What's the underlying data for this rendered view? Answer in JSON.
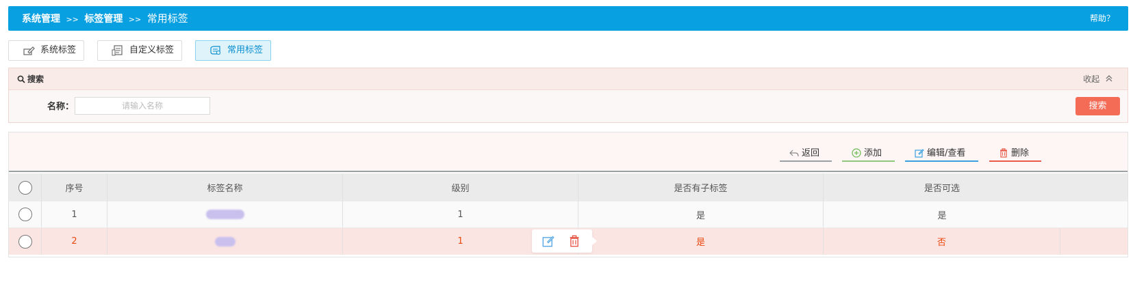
{
  "header": {
    "breadcrumb": [
      {
        "label": "系统管理"
      },
      {
        "sep": ">>"
      },
      {
        "label": "标签管理"
      },
      {
        "sep": ">>"
      },
      {
        "label": "常用标签"
      }
    ],
    "bc1": "系统管理",
    "sep1": ">>",
    "bc2": "标签管理",
    "sep2": ">>",
    "bc3": "常用标签",
    "help": "帮助？"
  },
  "tabs": [
    {
      "label": "系统标签",
      "icon": "pen-tag-icon",
      "active": false
    },
    {
      "label": "自定义标签",
      "icon": "document-list-icon",
      "active": false
    },
    {
      "label": "常用标签",
      "icon": "tag-stack-icon",
      "active": true
    }
  ],
  "search": {
    "title": "搜索",
    "collapse_label": "收起",
    "collapse_icon": "chevron-up-icon",
    "name_label": "名称：",
    "name_value": "",
    "name_placeholder": "请输入名称",
    "button_label": "搜索"
  },
  "toolbar": {
    "back": "返回",
    "add": "添加",
    "edit": "编辑/查看",
    "delete": "删除"
  },
  "table": {
    "columns": [
      "序号",
      "标签名称",
      "级别",
      "是否有子标签",
      "是否可选"
    ],
    "rows": [
      {
        "index": "1",
        "name": "",
        "level": "1",
        "has_children": "是",
        "selectable": "是"
      },
      {
        "index": "2",
        "name": "",
        "level": "1",
        "has_children": "是",
        "selectable": "否"
      }
    ]
  },
  "colors": {
    "header_bg": "#08a0e0",
    "accent_active_tab": "#dff3fb",
    "search_button": "#f46b56",
    "highlight_row": "#fbe5e2",
    "highlight_text": "#e8490f",
    "back_underline": "#9aa0a4",
    "add_underline": "#8fc77c",
    "edit_underline": "#3aa0e0",
    "delete_underline": "#e85a4a"
  }
}
